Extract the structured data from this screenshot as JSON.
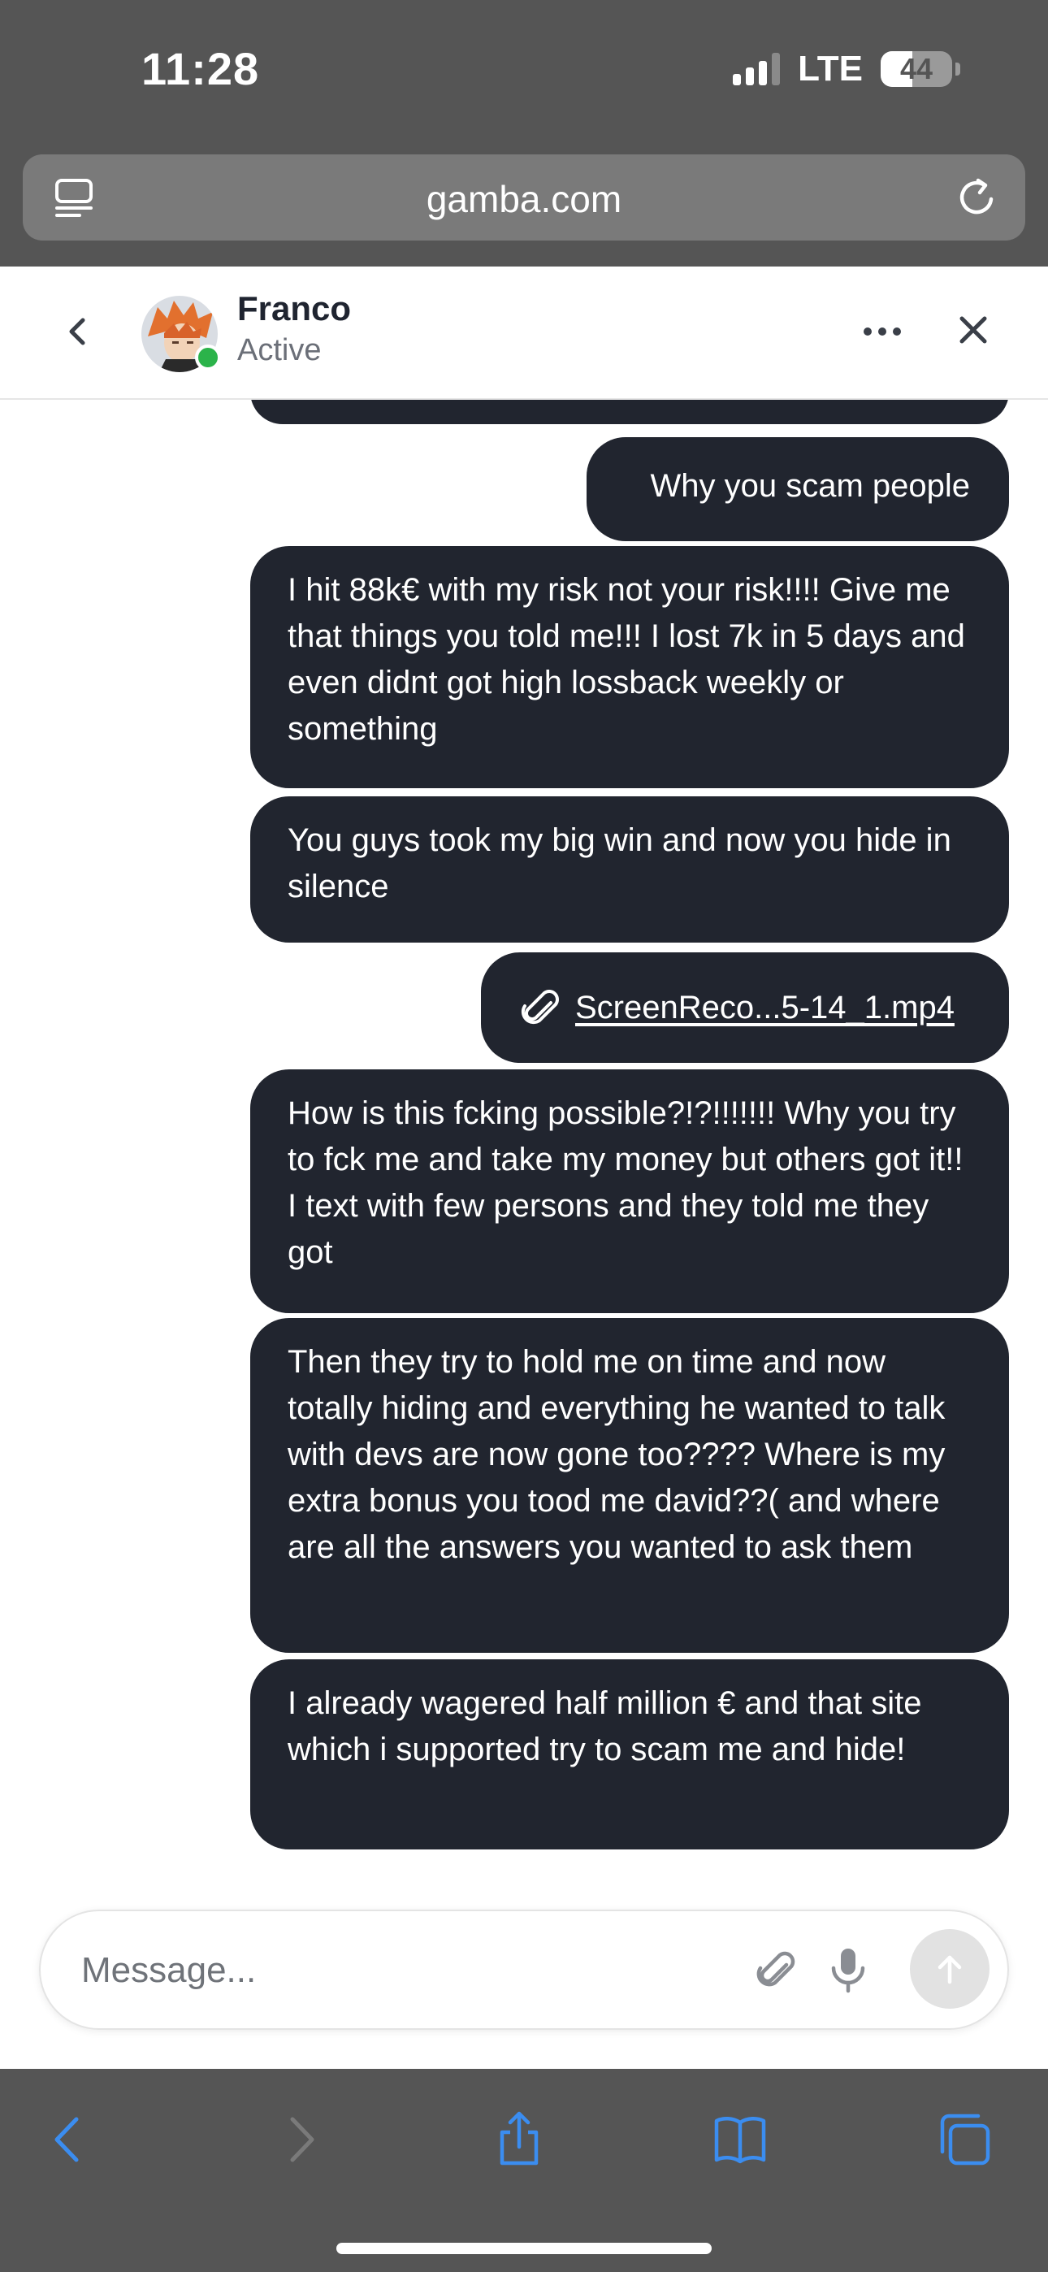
{
  "status_bar": {
    "time": "11:28",
    "network": "LTE",
    "battery": "44",
    "battery_level": 0.44,
    "signal_bars_active": 3,
    "signal_bars_total": 4
  },
  "browser": {
    "url": "gamba.com"
  },
  "chat": {
    "contact_name": "Franco",
    "contact_status": "Active",
    "online_color": "#2bb34a"
  },
  "messages": [
    {
      "type": "text",
      "text": ""
    },
    {
      "type": "text",
      "text": "Why you scam people"
    },
    {
      "type": "text",
      "text": "I hit 88k€ with my risk not your risk!!!! Give me that things you told me!!! I lost 7k in 5 days and even didnt got high lossback weekly or something"
    },
    {
      "type": "text",
      "text": "You guys took my big win and now you hide in silence"
    },
    {
      "type": "attachment",
      "text": "ScreenReco...5-14_1.mp4",
      "icon": "paperclip-icon"
    },
    {
      "type": "text",
      "text": "How is this fcking possible?!?!!!!!!! Why you try to fck me and take my money but others got it!! I text with few persons and they told me they got"
    },
    {
      "type": "text",
      "text": "Then they try to hold me on time and now totally hiding and everything he wanted to talk with devs are now gone too???? Where is my extra bonus you tood me david??( and where are all the answers you wanted to ask them"
    },
    {
      "type": "text",
      "text": "I already wagered half million € and that site which i supported try to scam me and hide!"
    }
  ],
  "composer": {
    "placeholder": "Message..."
  },
  "colors": {
    "chrome": "#555555",
    "bubble": "#21252f",
    "accent": "#2f7fe0"
  },
  "toolbar_icons": [
    "back-icon",
    "forward-icon",
    "share-icon",
    "bookmarks-icon",
    "tabs-icon"
  ]
}
